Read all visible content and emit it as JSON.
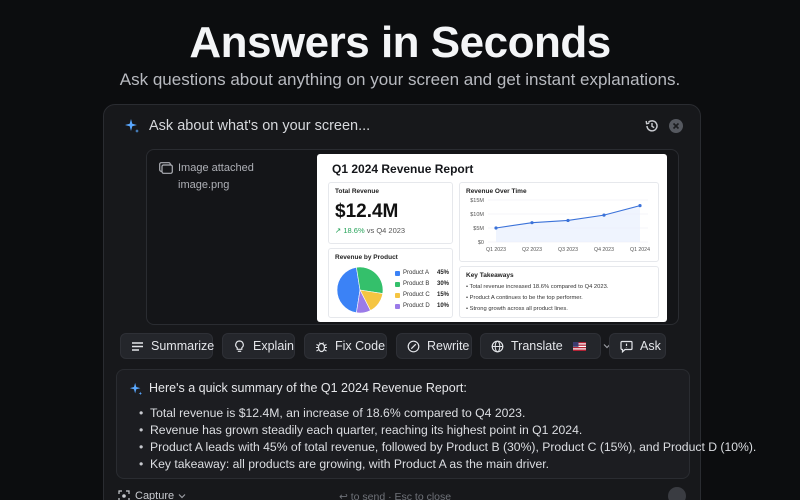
{
  "hero": {
    "title": "Answers in Seconds",
    "subtitle": "Ask questions about anything on your screen and get instant explanations."
  },
  "prompt": {
    "text": "Ask about what's on your screen...",
    "history_icon": "history-icon",
    "close_icon": "close-icon"
  },
  "attachment": {
    "label": "Image attached",
    "filename": "image.png"
  },
  "report": {
    "title": "Q1 2024 Revenue Report",
    "total": {
      "label": "Total Revenue",
      "value": "$12.4M",
      "change_pct": "18.6%",
      "change_rest": " vs Q4 2023"
    },
    "trend": {
      "label": "Revenue Over Time",
      "y_ticks": [
        "$15M",
        "$10M",
        "$5M",
        "$0"
      ],
      "x_ticks": [
        "Q1 2023",
        "Q2 2023",
        "Q3 2023",
        "Q4 2023",
        "Q1 2024"
      ]
    },
    "products": {
      "label": "Revenue by Product",
      "items": [
        {
          "name": "Product A",
          "pct": "45%",
          "color": "#3b82f6"
        },
        {
          "name": "Product B",
          "pct": "30%",
          "color": "#34c06b"
        },
        {
          "name": "Product C",
          "pct": "15%",
          "color": "#f5c542"
        },
        {
          "name": "Product D",
          "pct": "10%",
          "color": "#9b7be8"
        }
      ]
    },
    "takeaways": {
      "label": "Key Takeaways",
      "items": [
        "Total revenue increased 18.6% compared to Q4 2023.",
        "Product A continues to be the top performer.",
        "Strong growth across all product lines."
      ]
    }
  },
  "chart_data": [
    {
      "type": "line",
      "title": "Revenue Over Time",
      "x": [
        "Q1 2023",
        "Q2 2023",
        "Q3 2023",
        "Q4 2023",
        "Q1 2024"
      ],
      "series": [
        {
          "values": [
            5.0,
            6.9,
            7.7,
            9.6,
            13.0
          ]
        }
      ],
      "ylim": [
        0,
        15
      ],
      "y_ticks": [
        "$15M",
        "$10M",
        "$5M",
        "$0"
      ],
      "grid": true,
      "color": "#3b72d9"
    },
    {
      "type": "pie",
      "title": "Revenue by Product",
      "categories": [
        "Product A",
        "Product B",
        "Product C",
        "Product D"
      ],
      "values": [
        45,
        30,
        15,
        10
      ],
      "colors": [
        "#3b82f6",
        "#34c06b",
        "#f5c542",
        "#9b7be8"
      ],
      "legend": "right"
    }
  ],
  "actions": [
    {
      "label": "Summarize",
      "icon": "lines-icon"
    },
    {
      "label": "Explain",
      "icon": "lightbulb-icon"
    },
    {
      "label": "Fix Code",
      "icon": "bug-icon"
    },
    {
      "label": "Rewrite",
      "icon": "pencil-circle-icon"
    },
    {
      "label": "Translate",
      "icon": "globe-icon"
    },
    {
      "label": "Ask",
      "icon": "chat-bubble-icon"
    }
  ],
  "summary": {
    "heading": "Here's a quick summary of the Q1 2024 Revenue Report:",
    "bullets": [
      "Total revenue is $12.4M, an increase of 18.6% compared to Q4 2023.",
      "Revenue has grown steadily each quarter, reaching its highest point in Q1 2024.",
      "Product A leads with 45% of total revenue, followed by Product B (30%), Product C (15%), and Product D (10%).",
      "Key takeaway: all products are growing, with Product A as the main driver."
    ]
  },
  "footer": {
    "capture_label": "Capture",
    "hint": "↩ to send · Esc to close"
  },
  "colors": {
    "accent_sparkle": "#5aa8ff",
    "background": "#0c0d0f",
    "panel": "#17181b"
  }
}
